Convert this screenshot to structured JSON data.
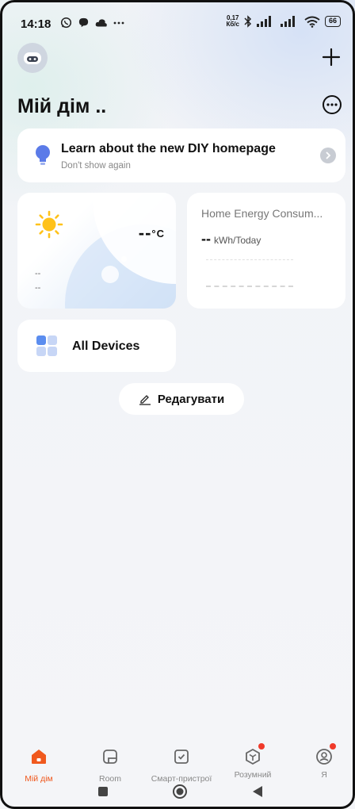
{
  "status_bar": {
    "time": "14:18",
    "net_speed_value": "0,17",
    "net_speed_unit": "Кб/с",
    "battery": "66"
  },
  "header": {
    "title": "Мій дім .."
  },
  "banner": {
    "title": "Learn about the new DIY homepage",
    "subtitle": "Don't show again"
  },
  "weather": {
    "temperature": "--",
    "unit": "°C",
    "line1": "--",
    "line2": "--",
    "icon": "sun-icon"
  },
  "energy": {
    "title": "Home Energy Consum...",
    "value": "--",
    "unit": "kWh/Today"
  },
  "all_devices": {
    "label": "All Devices"
  },
  "edit": {
    "label": "Редагувати"
  },
  "tabs": [
    {
      "label": "Мій дім",
      "icon": "home-icon",
      "active": true
    },
    {
      "label": "Room",
      "icon": "room-icon",
      "active": false
    },
    {
      "label": "Смарт-пристрої",
      "icon": "smart-device-icon",
      "active": false
    },
    {
      "label": "Розумний",
      "icon": "smart-scene-icon",
      "active": false
    },
    {
      "label": "Я",
      "icon": "profile-icon",
      "active": false
    }
  ],
  "colors": {
    "accent": "#f0591e",
    "badge": "#f03a2a",
    "sun": "#ffc21a",
    "bulb": "#5b7be8",
    "grid_icon": "#5b8def"
  }
}
